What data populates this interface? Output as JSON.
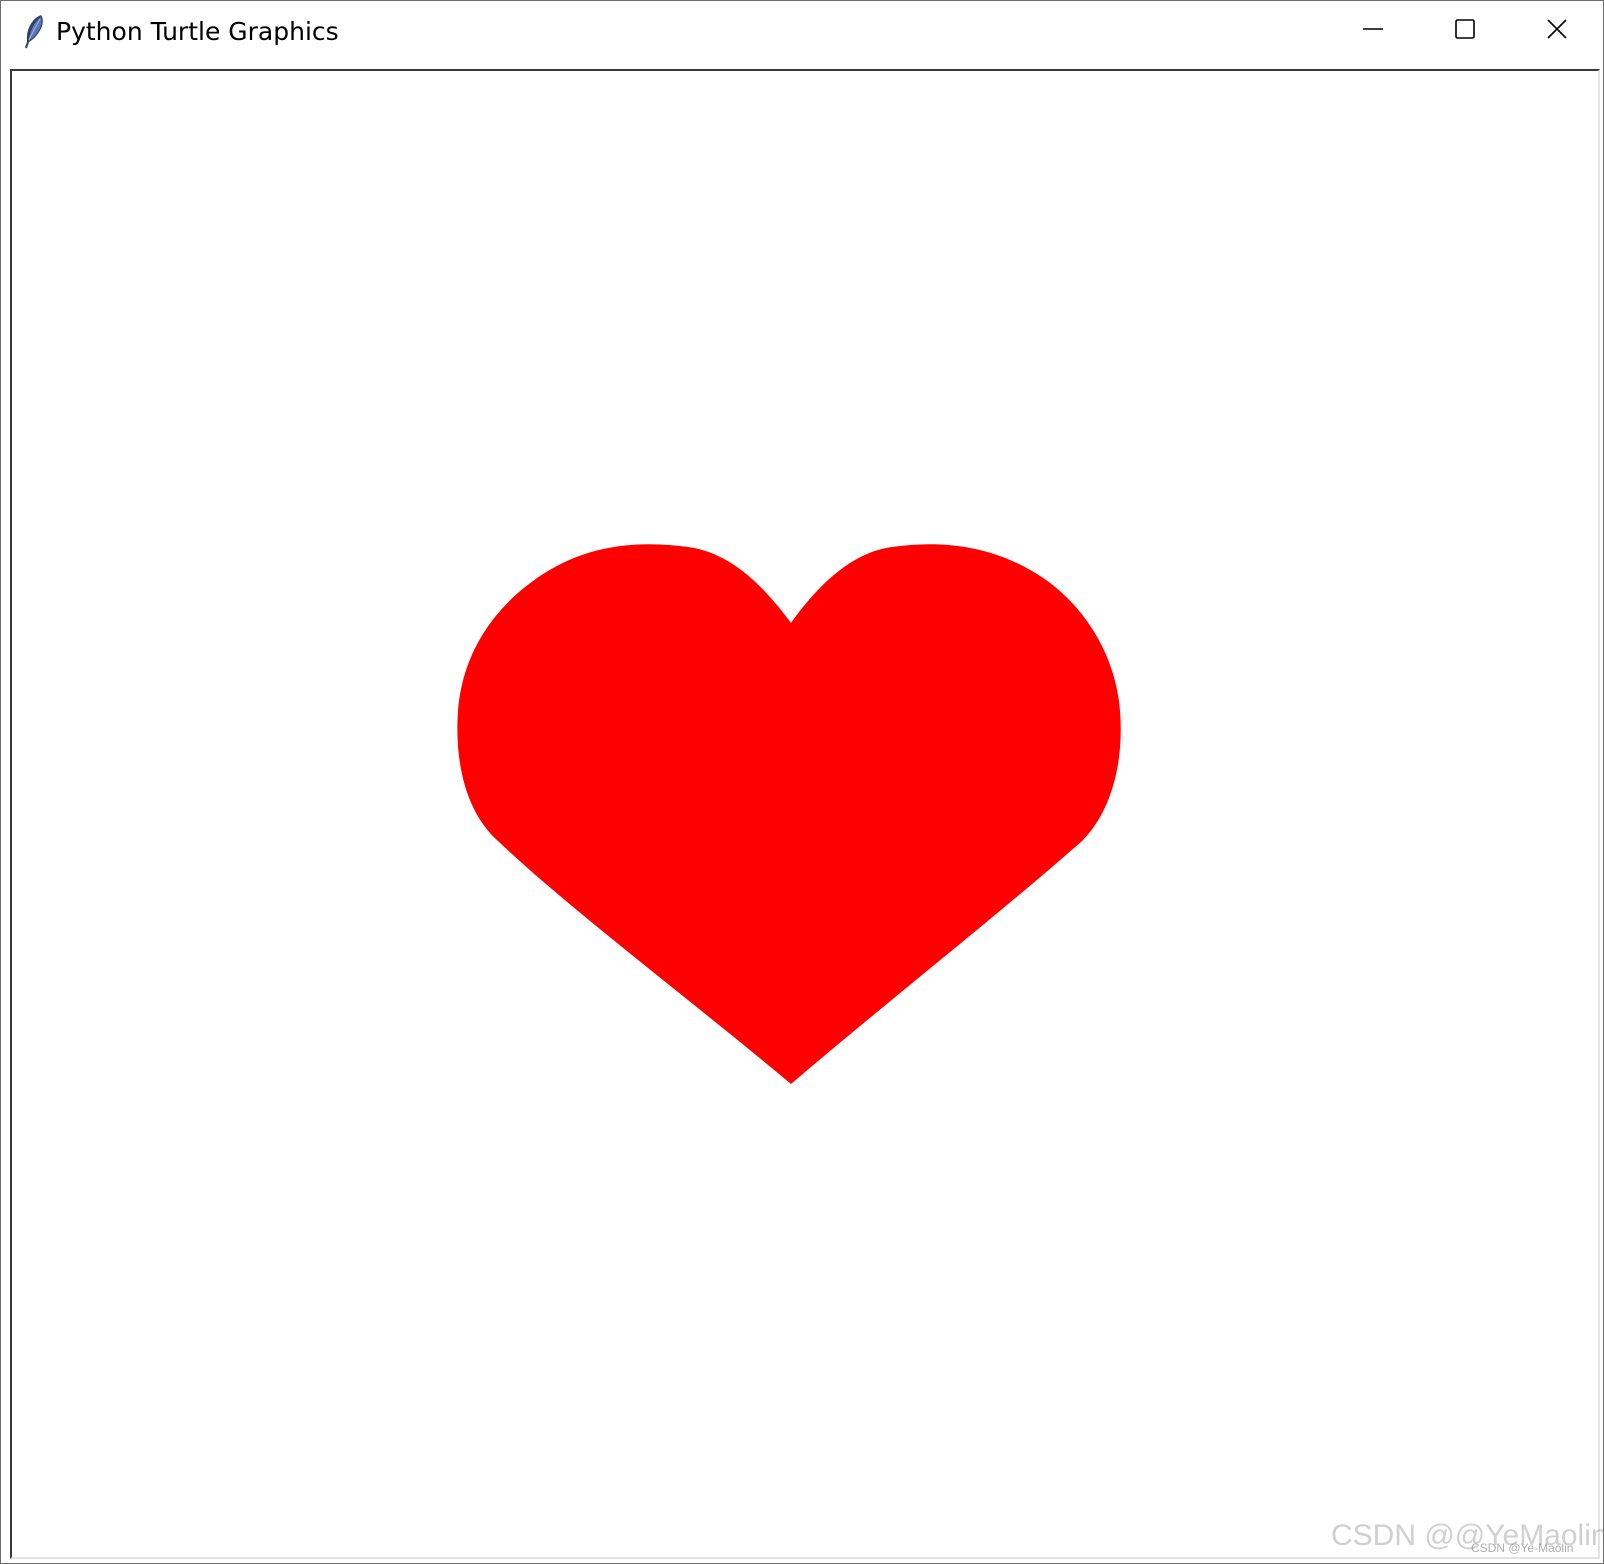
{
  "window": {
    "title": "Python Turtle Graphics",
    "app_icon": "feather-icon"
  },
  "controls": {
    "minimize_icon": "minimize-icon",
    "maximize_icon": "maximize-icon",
    "close_icon": "close-icon"
  },
  "canvas": {
    "background": "#ffffff",
    "shape": "heart",
    "fill_color": "#ff0000"
  },
  "watermark": {
    "large": "CSDN @@YeMaolin",
    "small": "CSDN @Ye-Maolin"
  }
}
